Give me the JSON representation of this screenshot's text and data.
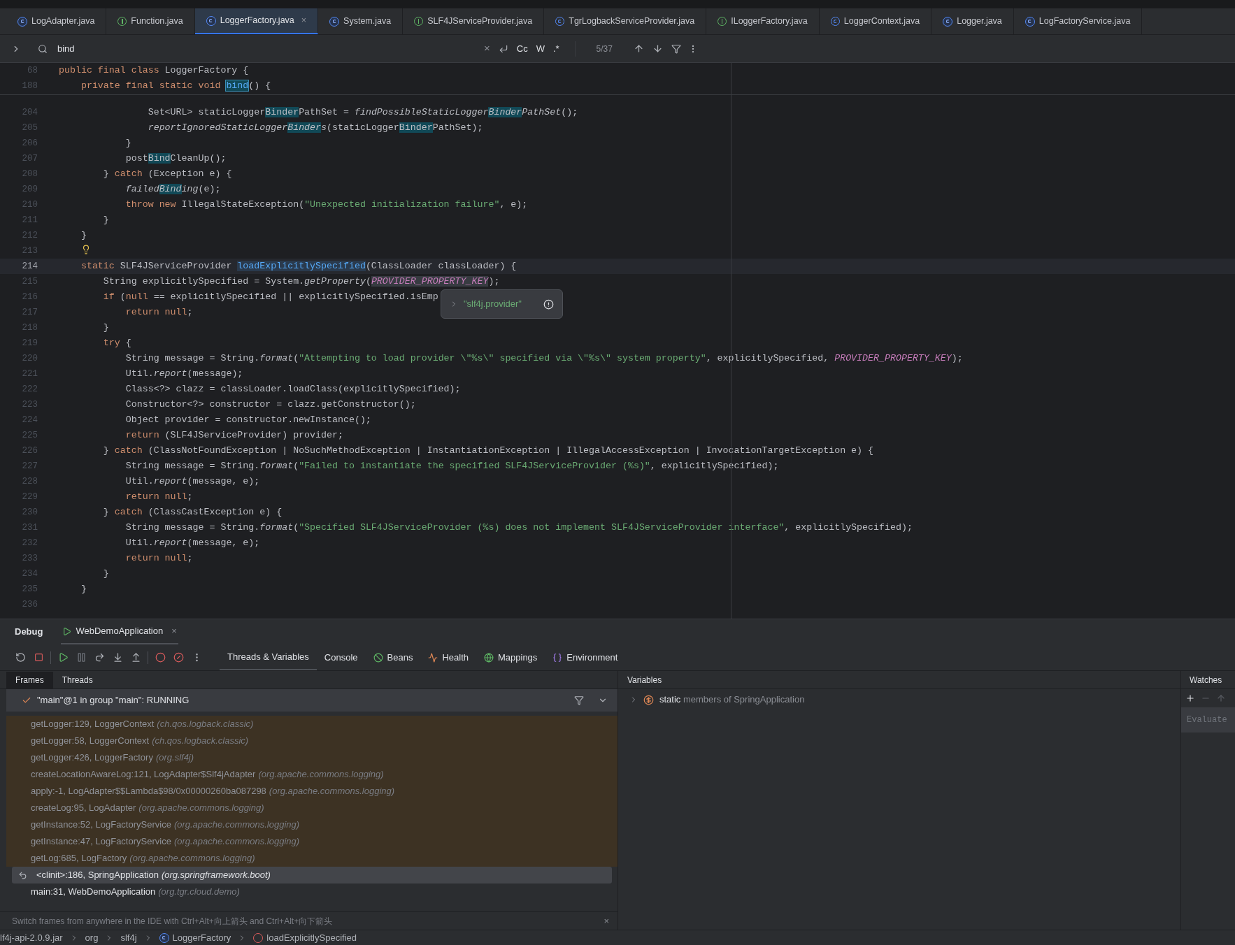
{
  "editor_tabs": [
    {
      "label": "LogAdapter.java",
      "kind": "compiled",
      "selected": false
    },
    {
      "label": "Function.java",
      "kind": "interface",
      "selected": false
    },
    {
      "label": "LoggerFactory.java",
      "kind": "compiled",
      "selected": true,
      "close": "×"
    },
    {
      "label": "System.java",
      "kind": "compiled",
      "selected": false
    },
    {
      "label": "SLF4JServiceProvider.java",
      "kind": "interface",
      "selected": false
    },
    {
      "label": "TgrLogbackServiceProvider.java",
      "kind": "class",
      "selected": false
    },
    {
      "label": "ILoggerFactory.java",
      "kind": "interface",
      "selected": false
    },
    {
      "label": "LoggerContext.java",
      "kind": "class",
      "selected": false
    },
    {
      "label": "Logger.java",
      "kind": "compiled",
      "selected": false
    },
    {
      "label": "LogFactoryService.java",
      "kind": "compiled",
      "selected": false
    }
  ],
  "search": {
    "value": "bind",
    "close": "×",
    "options": [
      "Cc",
      "W",
      ".*"
    ],
    "count": "5/37"
  },
  "sticky_lines": [
    {
      "number": "68",
      "tokens": [
        {
          "kind": "kw",
          "text": "public final class "
        },
        {
          "kind": "plain",
          "text": "LoggerFactory {"
        }
      ]
    },
    {
      "number": "188",
      "tokens": [
        {
          "kind": "kw",
          "text": "    private final static void "
        },
        {
          "kind": "decl-match",
          "text": "bind"
        },
        {
          "kind": "plain",
          "text": "() {"
        }
      ]
    }
  ],
  "lines": [
    {
      "number": "204",
      "current": false,
      "tokens": [
        {
          "kind": "plain",
          "text": "                Set<URL> staticLogger"
        },
        {
          "kind": "match",
          "text": "Binder"
        },
        {
          "kind": "plain",
          "text": "PathSet = "
        },
        {
          "kind": "italic",
          "text": "findPossibleStaticLogger"
        },
        {
          "kind": "italic-match",
          "text": "Binder"
        },
        {
          "kind": "italic",
          "text": "PathSet"
        },
        {
          "kind": "plain",
          "text": "();"
        }
      ]
    },
    {
      "number": "205",
      "current": false,
      "tokens": [
        {
          "kind": "italic",
          "text": "                reportIgnoredStaticLogger"
        },
        {
          "kind": "italic-match",
          "text": "Binder"
        },
        {
          "kind": "italic",
          "text": "s"
        },
        {
          "kind": "plain",
          "text": "(staticLogger"
        },
        {
          "kind": "match",
          "text": "Binder"
        },
        {
          "kind": "plain",
          "text": "PathSet);"
        }
      ]
    },
    {
      "number": "206",
      "current": false,
      "tokens": [
        {
          "kind": "plain",
          "text": "            }"
        }
      ]
    },
    {
      "number": "207",
      "current": false,
      "tokens": [
        {
          "kind": "plain",
          "text": "            post"
        },
        {
          "kind": "match",
          "text": "Bind"
        },
        {
          "kind": "plain",
          "text": "CleanUp();"
        }
      ]
    },
    {
      "number": "208",
      "current": false,
      "tokens": [
        {
          "kind": "plain",
          "text": "        } "
        },
        {
          "kind": "kw",
          "text": "catch"
        },
        {
          "kind": "plain",
          "text": " (Exception e) {"
        }
      ]
    },
    {
      "number": "209",
      "current": false,
      "tokens": [
        {
          "kind": "italic",
          "text": "            failed"
        },
        {
          "kind": "italic-match",
          "text": "Bind"
        },
        {
          "kind": "italic",
          "text": "ing"
        },
        {
          "kind": "plain",
          "text": "(e);"
        }
      ]
    },
    {
      "number": "210",
      "current": false,
      "tokens": [
        {
          "kind": "kw",
          "text": "            throw new "
        },
        {
          "kind": "plain",
          "text": "IllegalStateException("
        },
        {
          "kind": "str",
          "text": "\"Unexpected initialization failure\""
        },
        {
          "kind": "plain",
          "text": ", e);"
        }
      ]
    },
    {
      "number": "211",
      "current": false,
      "tokens": [
        {
          "kind": "plain",
          "text": "        }"
        }
      ]
    },
    {
      "number": "212",
      "current": false,
      "tokens": [
        {
          "kind": "plain",
          "text": "    }"
        }
      ]
    },
    {
      "number": "213",
      "current": false,
      "tokens": [
        {
          "kind": "bulb"
        }
      ]
    },
    {
      "number": "214",
      "current": true,
      "tokens": [
        {
          "kind": "kw",
          "text": "    static "
        },
        {
          "kind": "plain",
          "text": "SLF4JServiceProvider "
        },
        {
          "kind": "decl-usage",
          "text": "loadExplicitlySpecified"
        },
        {
          "kind": "plain",
          "text": "(ClassLoader classLoader) {"
        }
      ]
    },
    {
      "number": "215",
      "current": false,
      "tokens": [
        {
          "kind": "plain",
          "text": "        String explicitlySpecified = System."
        },
        {
          "kind": "italic",
          "text": "getProperty"
        },
        {
          "kind": "plain",
          "text": "("
        },
        {
          "kind": "const-usage",
          "text": "PROVIDER_PROPERTY_KEY"
        },
        {
          "kind": "plain",
          "text": ");"
        }
      ]
    },
    {
      "number": "216",
      "current": false,
      "tokens": [
        {
          "kind": "kw",
          "text": "        if "
        },
        {
          "kind": "plain",
          "text": "("
        },
        {
          "kind": "kw",
          "text": "null"
        },
        {
          "kind": "plain",
          "text": " == explicitlySpecified || explicitlySpecified.isEmp"
        }
      ]
    },
    {
      "number": "217",
      "current": false,
      "tokens": [
        {
          "kind": "kw",
          "text": "            return null"
        },
        {
          "kind": "plain",
          "text": ";"
        }
      ]
    },
    {
      "number": "218",
      "current": false,
      "tokens": [
        {
          "kind": "plain",
          "text": "        }"
        }
      ]
    },
    {
      "number": "219",
      "current": false,
      "tokens": [
        {
          "kind": "kw",
          "text": "        try"
        },
        {
          "kind": "plain",
          "text": " {"
        }
      ]
    },
    {
      "number": "220",
      "current": false,
      "tokens": [
        {
          "kind": "plain",
          "text": "            String message = String."
        },
        {
          "kind": "italic",
          "text": "format"
        },
        {
          "kind": "plain",
          "text": "("
        },
        {
          "kind": "str",
          "text": "\"Attempting to load provider \\\"%s\\\" specified via \\\"%s\\\" system property\""
        },
        {
          "kind": "plain",
          "text": ", explicitlySpecified, "
        },
        {
          "kind": "const",
          "text": "PROVIDER_PROPERTY_KEY"
        },
        {
          "kind": "plain",
          "text": ");"
        }
      ]
    },
    {
      "number": "221",
      "current": false,
      "tokens": [
        {
          "kind": "plain",
          "text": "            Util."
        },
        {
          "kind": "italic",
          "text": "report"
        },
        {
          "kind": "plain",
          "text": "(message);"
        }
      ]
    },
    {
      "number": "222",
      "current": false,
      "tokens": [
        {
          "kind": "plain",
          "text": "            Class<?> clazz = classLoader.loadClass(explicitlySpecified);"
        }
      ]
    },
    {
      "number": "223",
      "current": false,
      "tokens": [
        {
          "kind": "plain",
          "text": "            Constructor<?> constructor = clazz.getConstructor();"
        }
      ]
    },
    {
      "number": "224",
      "current": false,
      "tokens": [
        {
          "kind": "plain",
          "text": "            Object provider = constructor.newInstance();"
        }
      ]
    },
    {
      "number": "225",
      "current": false,
      "tokens": [
        {
          "kind": "kw",
          "text": "            return "
        },
        {
          "kind": "plain",
          "text": "(SLF4JServiceProvider) provider;"
        }
      ]
    },
    {
      "number": "226",
      "current": false,
      "tokens": [
        {
          "kind": "plain",
          "text": "        } "
        },
        {
          "kind": "kw",
          "text": "catch"
        },
        {
          "kind": "plain",
          "text": " (ClassNotFoundException | NoSuchMethodException | InstantiationException | IllegalAccessException | InvocationTargetException e) {"
        }
      ]
    },
    {
      "number": "227",
      "current": false,
      "tokens": [
        {
          "kind": "plain",
          "text": "            String message = String."
        },
        {
          "kind": "italic",
          "text": "format"
        },
        {
          "kind": "plain",
          "text": "("
        },
        {
          "kind": "str",
          "text": "\"Failed to instantiate the specified SLF4JServiceProvider (%s)\""
        },
        {
          "kind": "plain",
          "text": ", explicitlySpecified);"
        }
      ]
    },
    {
      "number": "228",
      "current": false,
      "tokens": [
        {
          "kind": "plain",
          "text": "            Util."
        },
        {
          "kind": "italic",
          "text": "report"
        },
        {
          "kind": "plain",
          "text": "(message, e);"
        }
      ]
    },
    {
      "number": "229",
      "current": false,
      "tokens": [
        {
          "kind": "kw",
          "text": "            return null"
        },
        {
          "kind": "plain",
          "text": ";"
        }
      ]
    },
    {
      "number": "230",
      "current": false,
      "tokens": [
        {
          "kind": "plain",
          "text": "        } "
        },
        {
          "kind": "kw",
          "text": "catch"
        },
        {
          "kind": "plain",
          "text": " (ClassCastException e) {"
        }
      ]
    },
    {
      "number": "231",
      "current": false,
      "tokens": [
        {
          "kind": "plain",
          "text": "            String message = String."
        },
        {
          "kind": "italic",
          "text": "format"
        },
        {
          "kind": "plain",
          "text": "("
        },
        {
          "kind": "str",
          "text": "\"Specified SLF4JServiceProvider (%s) does not implement SLF4JServiceProvider interface\""
        },
        {
          "kind": "plain",
          "text": ", explicitlySpecified);"
        }
      ]
    },
    {
      "number": "232",
      "current": false,
      "tokens": [
        {
          "kind": "plain",
          "text": "            Util."
        },
        {
          "kind": "italic",
          "text": "report"
        },
        {
          "kind": "plain",
          "text": "(message, e);"
        }
      ]
    },
    {
      "number": "233",
      "current": false,
      "tokens": [
        {
          "kind": "kw",
          "text": "            return null"
        },
        {
          "kind": "plain",
          "text": ";"
        }
      ]
    },
    {
      "number": "234",
      "current": false,
      "tokens": [
        {
          "kind": "plain",
          "text": "        }"
        }
      ]
    },
    {
      "number": "235",
      "current": false,
      "tokens": [
        {
          "kind": "plain",
          "text": "    }"
        }
      ]
    },
    {
      "number": "236",
      "current": false
    }
  ],
  "value_tooltip": {
    "value": "\"slf4j.provider\""
  },
  "debug": {
    "title": "Debug",
    "session": {
      "label": "WebDemoApplication",
      "close": "×"
    },
    "tabs": [
      {
        "label": "Threads & Variables",
        "kind": "plain",
        "selected": true
      },
      {
        "label": "Console",
        "kind": "plain",
        "selected": false
      },
      {
        "label": "Beans",
        "kind": "beans",
        "selected": false
      },
      {
        "label": "Health",
        "kind": "health",
        "selected": false
      },
      {
        "label": "Mappings",
        "kind": "mappings",
        "selected": false
      },
      {
        "label": "Environment",
        "kind": "environment",
        "selected": false
      }
    ],
    "frame_tabs": [
      {
        "label": "Frames",
        "selected": true
      },
      {
        "label": "Threads",
        "selected": false
      }
    ],
    "thread": "\"main\"@1 in group \"main\": RUNNING",
    "frames": [
      {
        "method": "getLogger:129, LoggerContext",
        "package": "(ch.qos.logback.classic)",
        "library": true,
        "selected": false
      },
      {
        "method": "getLogger:58, LoggerContext",
        "package": "(ch.qos.logback.classic)",
        "library": true,
        "selected": false
      },
      {
        "method": "getLogger:426, LoggerFactory",
        "package": "(org.slf4j)",
        "library": true,
        "selected": false
      },
      {
        "method": "createLocationAwareLog:121, LogAdapter$Slf4jAdapter",
        "package": "(org.apache.commons.logging)",
        "library": true,
        "selected": false
      },
      {
        "method": "apply:-1, LogAdapter$$Lambda$98/0x00000260ba087298",
        "package": "(org.apache.commons.logging)",
        "library": true,
        "selected": false
      },
      {
        "method": "createLog:95, LogAdapter",
        "package": "(org.apache.commons.logging)",
        "library": true,
        "selected": false
      },
      {
        "method": "getInstance:52, LogFactoryService",
        "package": "(org.apache.commons.logging)",
        "library": true,
        "selected": false
      },
      {
        "method": "getInstance:47, LogFactoryService",
        "package": "(org.apache.commons.logging)",
        "library": true,
        "selected": false
      },
      {
        "method": "getLog:685, LogFactory",
        "package": "(org.apache.commons.logging)",
        "library": true,
        "selected": false
      },
      {
        "method": "<clinit>:186, SpringApplication",
        "package": "(org.springframework.boot)",
        "library": false,
        "selected": true
      },
      {
        "method": "main:31, WebDemoApplication",
        "package": "(org.tgr.cloud.demo)",
        "library": false,
        "selected": false
      }
    ],
    "tip": {
      "text": "Switch frames from anywhere in the IDE with Ctrl+Alt+向上箭头 and Ctrl+Alt+向下箭头",
      "close": "×"
    },
    "variables": {
      "title": "Variables",
      "rows": [
        {
          "text": "**static** members of SpringApplication",
          "expanded": false
        }
      ]
    },
    "watches": {
      "title": "Watches",
      "placeholder": "Evaluate"
    }
  },
  "breadcrumbs": [
    {
      "label": "lf4j-api-2.0.9.jar",
      "kind": "plain"
    },
    {
      "label": "org",
      "kind": "plain"
    },
    {
      "label": "slf4j",
      "kind": "plain"
    },
    {
      "label": "LoggerFactory",
      "kind": "class"
    },
    {
      "label": "loadExplicitlySpecified",
      "kind": "method"
    }
  ]
}
